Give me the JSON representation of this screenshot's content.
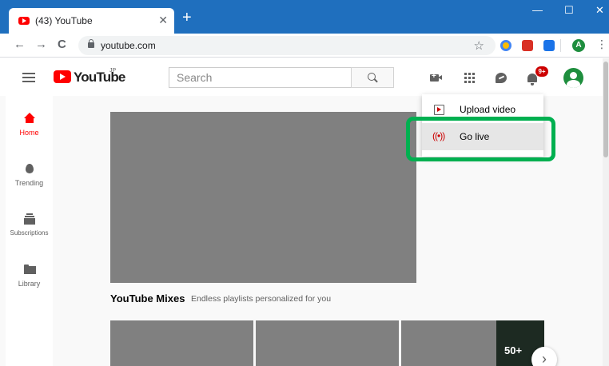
{
  "browser": {
    "tab_title": "(43) YouTube",
    "tab_close": "✕",
    "new_tab": "+",
    "window_controls": {
      "minimize": "—",
      "maximize": "☐",
      "close": "✕"
    },
    "nav": {
      "back": "←",
      "forward": "→",
      "reload": "C"
    },
    "url": "youtube.com",
    "star": "☆",
    "profile_initial": "A",
    "menu": "⋮"
  },
  "youtube": {
    "logo_text": "YouTube",
    "country_code": "JP",
    "search": {
      "placeholder": "Search"
    },
    "notification_badge": "9+",
    "guide": [
      {
        "label": "Home",
        "icon": "home-icon",
        "active": true
      },
      {
        "label": "Trending",
        "icon": "flame-icon"
      },
      {
        "label": "Subscriptions",
        "icon": "subscriptions-icon"
      },
      {
        "label": "Library",
        "icon": "folder-icon"
      }
    ],
    "shelf": {
      "title": "YouTube Mixes",
      "subtitle": "Endless playlists personalized for you",
      "mix_count": "50+"
    },
    "next_arrow": "›",
    "upload_menu": {
      "items": [
        {
          "label": "Upload video",
          "icon": "upload-video-icon"
        },
        {
          "label": "Go live",
          "icon": "go-live-icon",
          "icon_glyph": "(•))"
        }
      ],
      "live_glyph": "((•))"
    }
  },
  "colors": {
    "titlebar": "#1f6fbe",
    "youtube_red": "#ff0000",
    "highlight": "#00b050",
    "thumbnail": "#808080"
  }
}
